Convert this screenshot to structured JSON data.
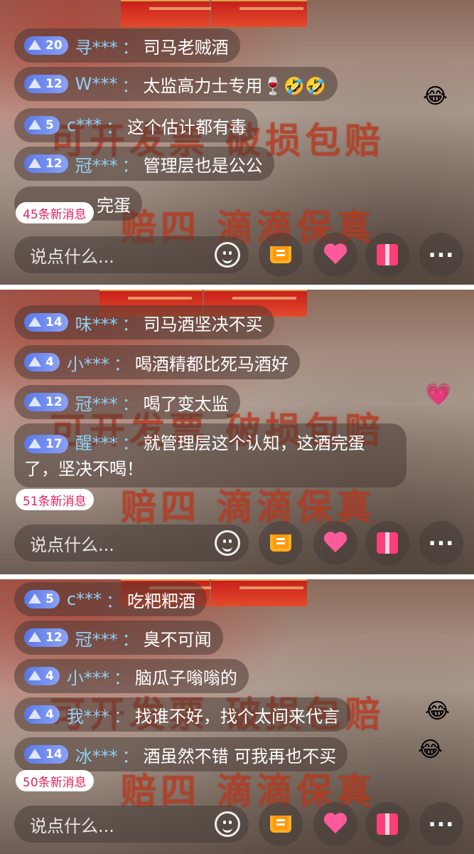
{
  "panels": [
    {
      "messages": [
        {
          "level": "20",
          "user": "寻***",
          "text": "司马老贼酒"
        },
        {
          "level": "12",
          "user": "W***",
          "text": "太监高力士专用🍷🤣🤣"
        },
        {
          "level": "5",
          "user": "c***",
          "text": "这个估计都有毒"
        },
        {
          "level": "12",
          "user": "冠***",
          "text": "管理层也是公公"
        },
        {
          "level": "",
          "user": "",
          "text": "完蛋"
        }
      ],
      "new_messages": "45条新消息"
    },
    {
      "messages": [
        {
          "level": "14",
          "user": "味***",
          "text": "司马酒坚决不买"
        },
        {
          "level": "4",
          "user": "小***",
          "text": "喝酒精都比死马酒好"
        },
        {
          "level": "12",
          "user": "冠***",
          "text": "喝了变太监"
        },
        {
          "level": "17",
          "user": "醒***",
          "text": "就管理层这个认知，这酒完蛋了，坚决不喝！"
        }
      ],
      "new_messages": "51条新消息"
    },
    {
      "messages": [
        {
          "level": "5",
          "user": "c***",
          "text": "吃粑粑酒"
        },
        {
          "level": "12",
          "user": "冠***",
          "text": "臭不可闻"
        },
        {
          "level": "4",
          "user": "小***",
          "text": "脑瓜子嗡嗡的"
        },
        {
          "level": "4",
          "user": "我***",
          "text": "找谁不好，找个太间来代言"
        },
        {
          "level": "14",
          "user": "冰***",
          "text": "酒虽然不错 可我再也不买"
        }
      ],
      "new_messages": "50条新消息"
    }
  ],
  "watermark": {
    "line1": "可开发票  破损包赔",
    "line2": "赔四  滴滴保真"
  },
  "input_placeholder": "说点什么...",
  "colon": "："
}
